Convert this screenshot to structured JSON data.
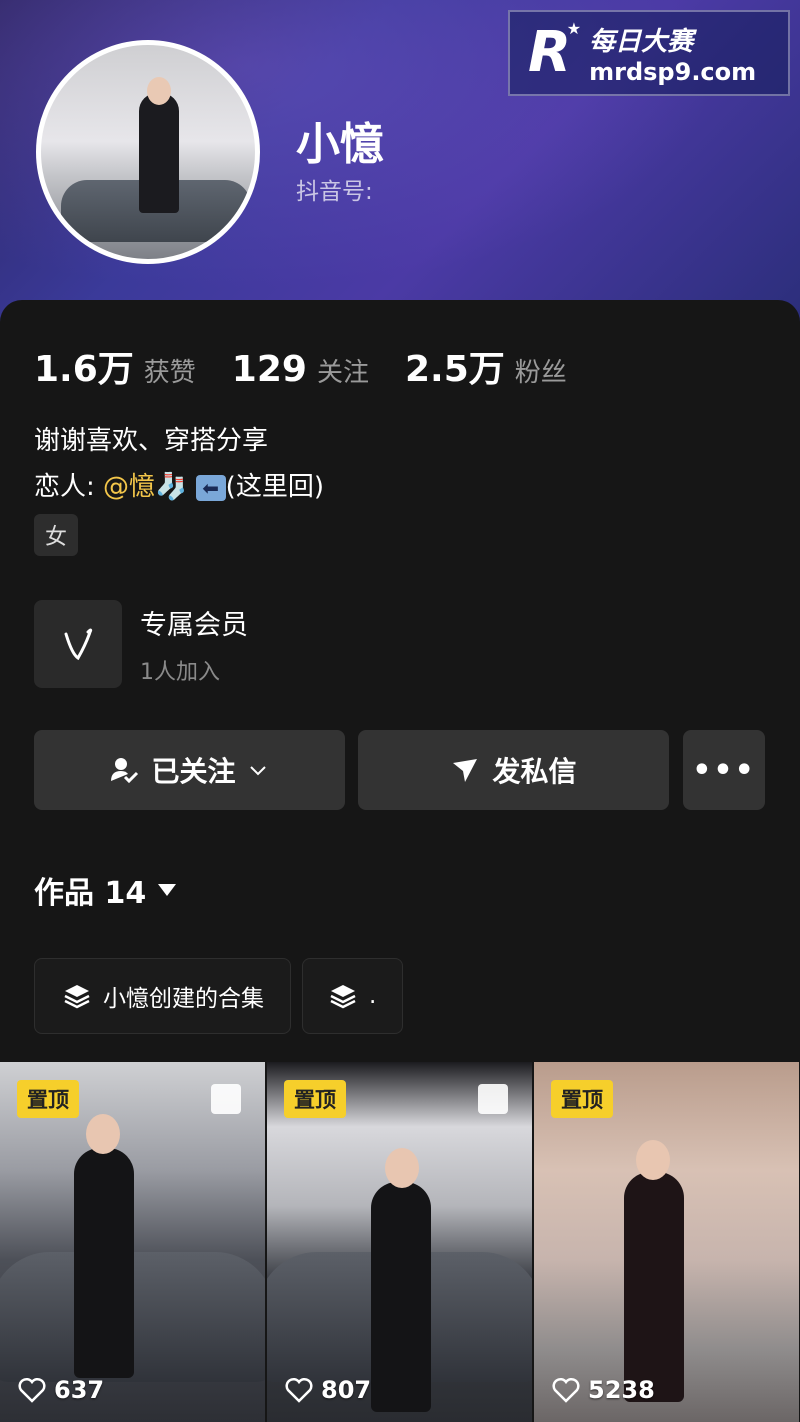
{
  "profile": {
    "name": "小憶",
    "douyin_id_label": "抖音号:"
  },
  "watermark": {
    "logo_letter": "R",
    "site_name": "每日大赛",
    "url": "mrdsp9.com"
  },
  "stats": [
    {
      "value": "1.6万",
      "label": "获赞"
    },
    {
      "value": "129",
      "label": "关注"
    },
    {
      "value": "2.5万",
      "label": "粉丝"
    }
  ],
  "bio": {
    "line1": "谢谢喜欢、穿搭分享",
    "line2_prefix": "恋人:",
    "line2_mention": "@憶🧦",
    "line2_arrow": "⬅",
    "line2_suffix": "(这里回)"
  },
  "gender_tag": "女",
  "membership": {
    "title": "专属会员",
    "subtitle": "1人加入"
  },
  "actions": {
    "follow_label": "已关注",
    "message_label": "发私信",
    "more_label": "•••"
  },
  "works_tab": {
    "label": "作品 14"
  },
  "collections": [
    {
      "label": "小憶创建的合集"
    },
    {
      "label": "."
    }
  ],
  "videos": [
    {
      "pinned_label": "置顶",
      "likes": "637"
    },
    {
      "pinned_label": "置顶",
      "likes": "807"
    },
    {
      "pinned_label": "置顶",
      "likes": "5238"
    }
  ],
  "colors": {
    "header_gradient": [
      "#2a2560",
      "#4b3aa5"
    ],
    "background": "#161616",
    "button": "#333333",
    "pin_badge": "#f6cf2b",
    "mention": "#f3c64a"
  }
}
